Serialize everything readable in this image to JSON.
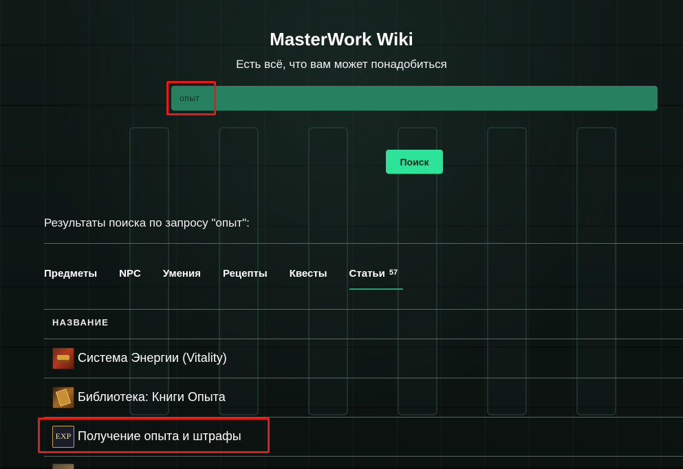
{
  "header": {
    "title": "MasterWork Wiki",
    "subtitle": "Есть всё, что вам может понадобиться"
  },
  "search": {
    "value": "опыт",
    "button_label": "Поиск"
  },
  "results": {
    "heading": "Результаты поиска по запросу \"опыт\":"
  },
  "tabs": [
    {
      "label": "Предметы",
      "count": "",
      "active": false
    },
    {
      "label": "NPC",
      "count": "",
      "active": false
    },
    {
      "label": "Умения",
      "count": "",
      "active": false
    },
    {
      "label": "Рецепты",
      "count": "",
      "active": false
    },
    {
      "label": "Квесты",
      "count": "",
      "active": false
    },
    {
      "label": "Статьи",
      "count": "57",
      "active": true
    }
  ],
  "table": {
    "column_header": "НАЗВАНИЕ",
    "rows": [
      {
        "label": "Система Энергии (Vitality)",
        "icon": "energy-chest-icon"
      },
      {
        "label": "Библиотека: Книги Опыта",
        "icon": "experience-book-icon"
      },
      {
        "label": "Получение опыта и штрафы",
        "icon": "exp-icon",
        "icon_text": "EXP"
      }
    ]
  },
  "colors": {
    "accent": "#2de39a",
    "search_bar": "#278060",
    "highlight": "#e31b1b"
  }
}
